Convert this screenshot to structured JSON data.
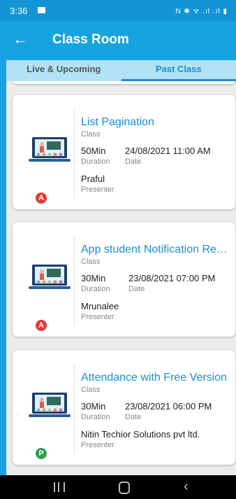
{
  "status": {
    "time": "3:36",
    "icons": "N ✱ ᯤ .ıl .ıl ▮"
  },
  "app_bar": {
    "title": "Class Room"
  },
  "tabs": [
    {
      "label": "Live & Upcoming",
      "active": false
    },
    {
      "label": "Past Class",
      "active": true
    }
  ],
  "labels": {
    "type": "Class",
    "duration": "Duration",
    "date": "Date",
    "presenter": "Presenter"
  },
  "cards": [
    {
      "title": "List Pagination",
      "duration": "50Min",
      "datetime": "24/08/2021 11:00 AM",
      "presenter": "Praful",
      "badge": "A",
      "badge_color": "#e53935"
    },
    {
      "title": "App student Notification Reminder",
      "duration": "30Min",
      "datetime": "23/08/2021 07:00 PM",
      "presenter": "Mrunalee",
      "badge": "A",
      "badge_color": "#e53935"
    },
    {
      "title": "Attendance with Free Version",
      "duration": "30Min",
      "datetime": "23/08/2021 06:00 PM",
      "presenter": "Nitin Techior Solutions pvt ltd.",
      "badge": "P",
      "badge_color": "#2e9e4f"
    }
  ],
  "colors": {
    "primary": "#16a3df",
    "accent": "#1a8fd0",
    "absent": "#e53935",
    "present": "#2e9e4f"
  }
}
